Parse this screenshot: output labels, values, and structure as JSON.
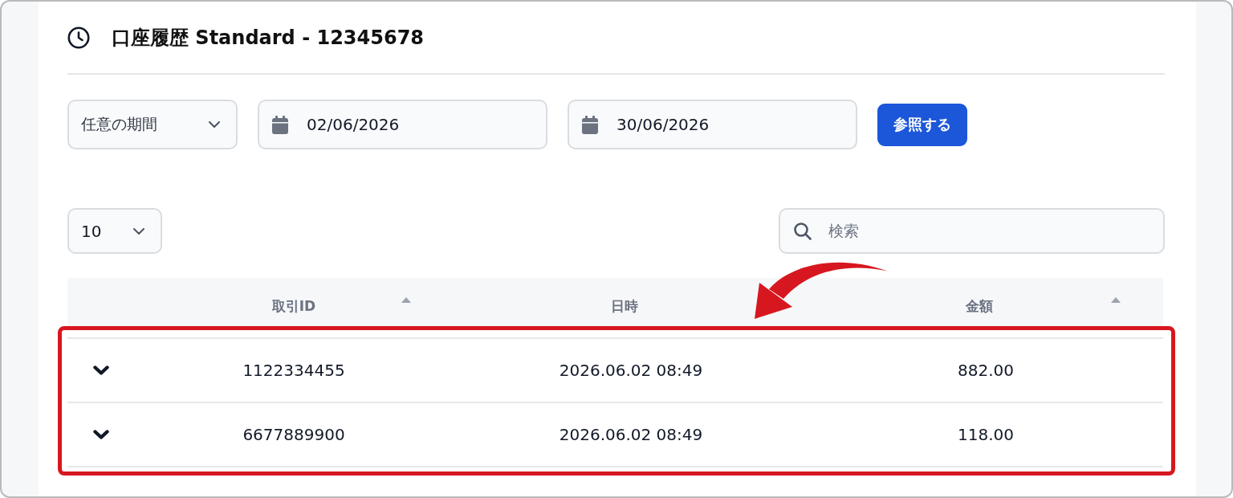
{
  "header": {
    "title": "口座履歴 Standard - 12345678"
  },
  "filters": {
    "period": {
      "value": "任意の期間"
    },
    "date_from": {
      "value": "02/06/2026"
    },
    "date_to": {
      "value": "30/06/2026"
    },
    "submit_button": {
      "label": "参照する"
    }
  },
  "table_controls": {
    "page_size": {
      "value": "10"
    },
    "search": {
      "placeholder": "検索"
    }
  },
  "table": {
    "columns": [
      {
        "label": "取引ID",
        "sortable": true
      },
      {
        "label": "日時",
        "sortable": false
      },
      {
        "label": "金額",
        "sortable": true
      }
    ],
    "rows": [
      {
        "id": "1122334455",
        "datetime": "2026.06.02 08:49",
        "amount": "882.00"
      },
      {
        "id": "6677889900",
        "datetime": "2026.06.02 08:49",
        "amount": "118.00"
      }
    ]
  },
  "annotations": {
    "highlight_frame": true,
    "pointer_arrow": true
  }
}
